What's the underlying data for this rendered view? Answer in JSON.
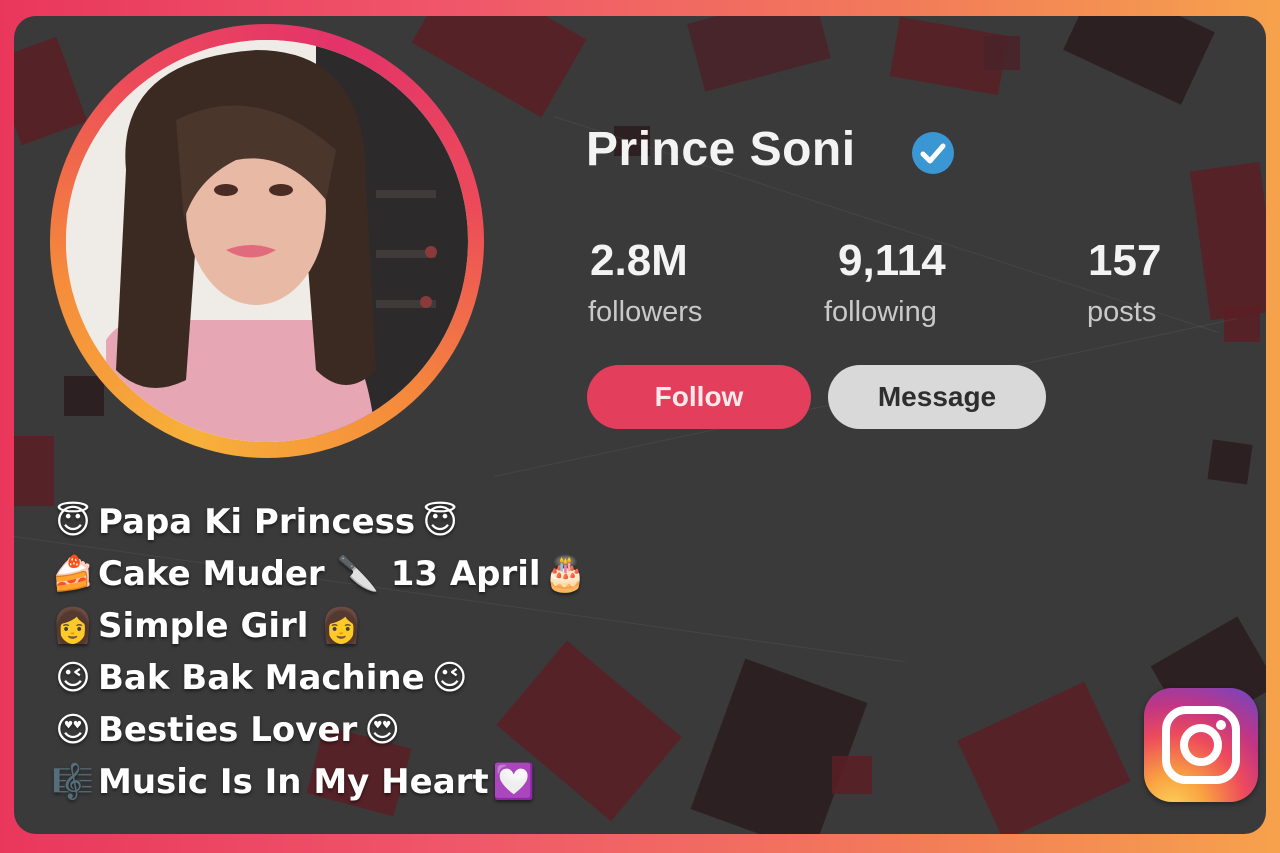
{
  "profile": {
    "name": "Prince Soni",
    "verified_icon": "verified-check-icon",
    "stats": [
      {
        "value": "2.8M",
        "label": "followers"
      },
      {
        "value": "9,114",
        "label": "following"
      },
      {
        "value": "157",
        "label": "posts"
      }
    ],
    "follow_label": "Follow",
    "message_label": "Message"
  },
  "bio": [
    {
      "lead": "😇",
      "text": "Papa Ki Princess",
      "trail": "😇"
    },
    {
      "lead": "🍰",
      "text": "Cake Muder 🔪 13 April",
      "trail": "🎂"
    },
    {
      "lead": "👩",
      "text": " Simple Girl 👩",
      "trail": ""
    },
    {
      "lead": "😉",
      "text": "Bak Bak Machine",
      "trail": "😉"
    },
    {
      "lead": "😍",
      "text": "Besties Lover",
      "trail": "😍"
    },
    {
      "lead": "🎼",
      "text": " Music Is In My Heart",
      "trail": "💟"
    }
  ],
  "colors": {
    "follow": "#e33e5c",
    "message": "#d9d9d9",
    "verified": "#3b97d3",
    "card": "#3a3a3b"
  },
  "icons": {
    "brand": "instagram-icon"
  }
}
